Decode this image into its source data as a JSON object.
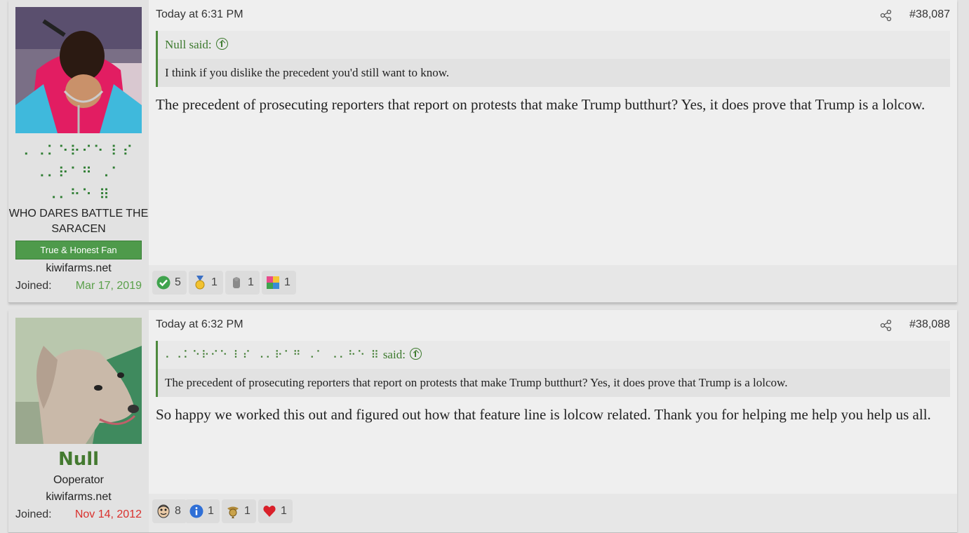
{
  "posts": [
    {
      "time": "Today at 6:31 PM",
      "number": "#38,087",
      "user": {
        "name": "⠄⠠⠅⠑⠗⠊⠑ ⠇⠎ ⠠⠄⠗⠁⠛ ⠠⠁ ⠠⠄⠓⠑ ⠿",
        "name_lines": [
          "⠄⠠⠅⠑⠗⠊⠑ ⠇⠎",
          "⠠⠄⠗⠁⠛ ⠠⠁",
          "⠠⠄⠓⠑ ⠿"
        ],
        "title": "WHO DARES BATTLE THE SARACEN",
        "banner": "True & Honest Fan",
        "site": "kiwifarms.net",
        "joined_label": "Joined:",
        "joined_date": "Mar 17, 2019"
      },
      "quote": {
        "author": "Null said:",
        "text": "I think if you dislike the precedent you'd still want to know."
      },
      "body": "The precedent of prosecuting reporters that report on protests that make Trump butthurt? Yes, it does prove that Trump is a lolcow.",
      "reactions": [
        {
          "icon": "check-icon",
          "count": "5"
        },
        {
          "icon": "medal-icon",
          "count": "1"
        },
        {
          "icon": "gray-figure-icon",
          "count": "1"
        },
        {
          "icon": "puzzle-icon",
          "count": "1"
        }
      ]
    },
    {
      "time": "Today at 6:32 PM",
      "number": "#38,088",
      "user": {
        "name": "Null",
        "title": "Ooperator",
        "site": "kiwifarms.net",
        "joined_label": "Joined:",
        "joined_date": "Nov 14, 2012"
      },
      "quote": {
        "author_braille": "⠄⠠⠅⠑⠗⠊⠑ ⠇⠎ ⠠⠄⠗⠁⠛ ⠠⠁ ⠠⠄⠓⠑ ⠿",
        "author_suffix": "said:",
        "text": "The precedent of prosecuting reporters that report on protests that make Trump butthurt? Yes, it does prove that Trump is a lolcow."
      },
      "body": "So happy we worked this out and figured out how that feature line is lolcow related. Thank you for helping me help you help us all.",
      "reactions": [
        {
          "icon": "face-icon",
          "count": "8"
        },
        {
          "icon": "info-icon",
          "count": "1"
        },
        {
          "icon": "eagle-emblem-icon",
          "count": "1"
        },
        {
          "icon": "heart-icon",
          "count": "1"
        }
      ]
    }
  ],
  "colors": {
    "accent_green": "#4e9a4b",
    "joined_green": "#5aa04a",
    "joined_red": "#d9302c"
  }
}
